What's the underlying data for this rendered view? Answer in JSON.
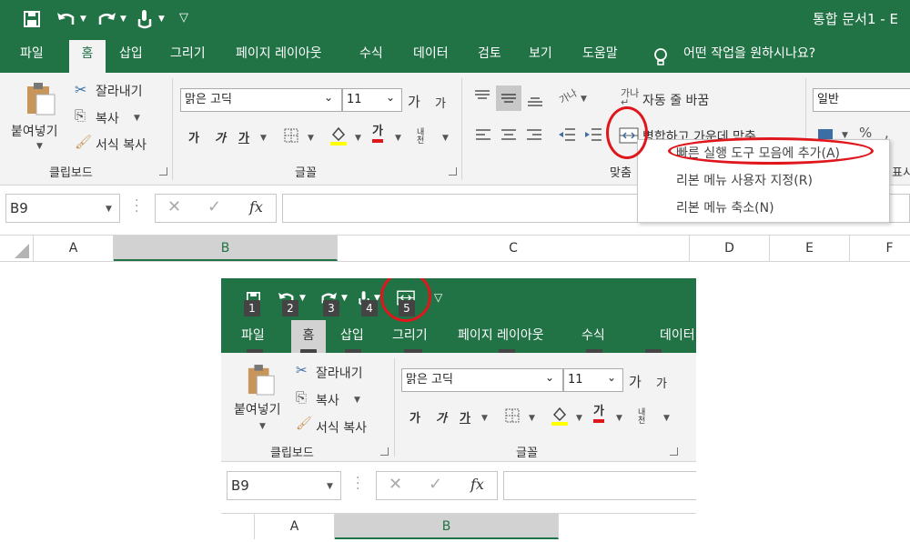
{
  "top": {
    "title": "통합 문서1 - E",
    "tabs": [
      "파일",
      "홈",
      "삽입",
      "그리기",
      "페이지 레이아웃",
      "수식",
      "데이터",
      "검토",
      "보기",
      "도움말"
    ],
    "active_tab": "홈",
    "tell_me": "어떤 작업을 원하시나요?",
    "clipboard": {
      "paste": "붙여넣기",
      "cut": "잘라내기",
      "copy": "복사",
      "format_painter": "서식 복사",
      "group": "클립보드"
    },
    "font": {
      "name": "맑은 고딕",
      "size": "11",
      "group": "글꼴",
      "bold": "가",
      "italic": "가",
      "underline": "가",
      "grow": "가",
      "shrink": "가",
      "font_color": "가",
      "phonetic": "내천"
    },
    "alignment": {
      "wrap_text": "자동 줄 바꿈",
      "merge_center": "병합하고 가운데 맞춤",
      "group": "맞춤",
      "orient": "가나"
    },
    "number": {
      "format": "일반",
      "group": "표시"
    },
    "name_box": "B9",
    "fx": "fx",
    "columns": [
      "A",
      "B",
      "C",
      "D",
      "E",
      "F"
    ],
    "context_menu": [
      "빠른 실행 도구 모음에 추가(A)",
      "리본 메뉴 사용자 지정(R)",
      "리본 메뉴 축소(N)"
    ]
  },
  "bottom": {
    "tabs": [
      "파일",
      "홈",
      "삽입",
      "그리기",
      "페이지 레이아웃",
      "수식",
      "데이터"
    ],
    "keytips_qat": [
      "1",
      "2",
      "3",
      "4",
      "5"
    ],
    "keytips_tabs": [
      "F",
      "H",
      "N",
      "JI",
      "P",
      "M",
      "A"
    ],
    "clipboard": {
      "paste": "붙여넣기",
      "cut": "잘라내기",
      "copy": "복사",
      "format_painter": "서식 복사",
      "group": "클립보드"
    },
    "font": {
      "name": "맑은 고딕",
      "size": "11",
      "group": "글꼴",
      "bold": "가",
      "italic": "가",
      "underline": "가",
      "grow": "가",
      "shrink": "가",
      "font_color": "가",
      "phonetic": "내천"
    },
    "name_box": "B9",
    "fx": "fx",
    "columns": [
      "A",
      "B"
    ]
  },
  "colors": {
    "excel_green": "#217346",
    "annotation_red": "#e0161d",
    "ribbon_bg": "#f3f3f3"
  }
}
